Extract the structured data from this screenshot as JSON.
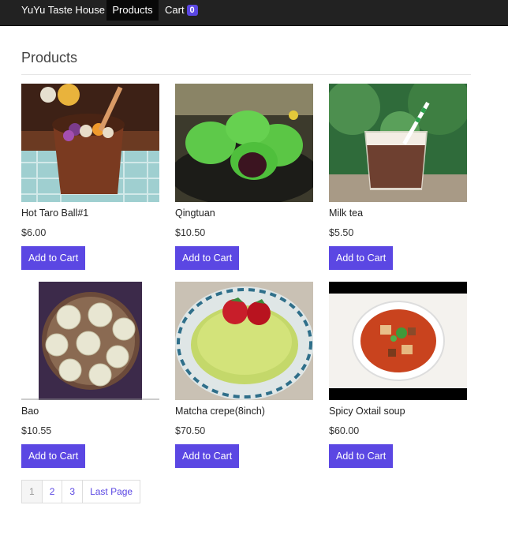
{
  "nav": {
    "brand": "YuYu Taste House",
    "products": "Products",
    "cart": "Cart",
    "cart_count": "0"
  },
  "page": {
    "title": "Products"
  },
  "products": [
    {
      "name": "Hot Taro Ball#1",
      "price": "$6.00",
      "button": "Add to Cart"
    },
    {
      "name": "Qingtuan",
      "price": "$10.50",
      "button": "Add to Cart"
    },
    {
      "name": "Milk tea",
      "price": "$5.50",
      "button": "Add to Cart"
    },
    {
      "name": "Bao",
      "price": "$10.55",
      "button": "Add to Cart"
    },
    {
      "name": "Matcha crepe(8inch)",
      "price": "$70.50",
      "button": "Add to Cart"
    },
    {
      "name": "Spicy Oxtail soup",
      "price": "$60.00",
      "button": "Add to Cart"
    }
  ],
  "pagination": {
    "pages": [
      "1",
      "2",
      "3"
    ],
    "last": "Last Page",
    "current": "1"
  },
  "colors": {
    "accent": "#5b47e3",
    "navbar": "#222222"
  }
}
